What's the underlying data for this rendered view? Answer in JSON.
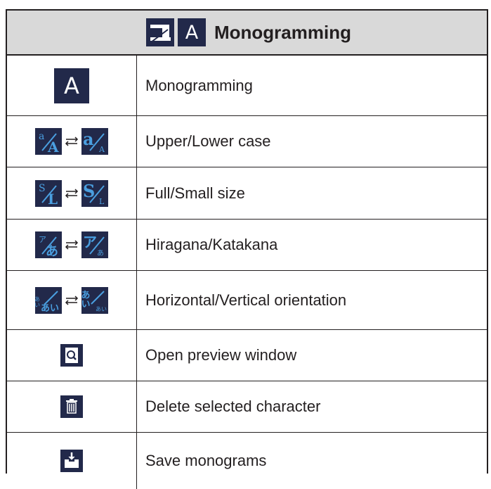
{
  "header": {
    "title": "Monogramming",
    "a_icon": "A",
    "machine_icon": "sewing-machine-icon"
  },
  "rows": [
    {
      "label": "Monogramming",
      "icon": "monogram-a-icon",
      "glyph": "A"
    },
    {
      "label": "Upper/Lower case",
      "icon_left": "case-lower-icon",
      "icon_right": "case-upper-icon",
      "left_top": "a",
      "left_bottom": "A",
      "right_top": "a",
      "right_bottom": "A"
    },
    {
      "label": "Full/Small size",
      "icon_left": "size-small-icon",
      "icon_right": "size-full-icon",
      "left_top": "S",
      "left_bottom": "L",
      "right_top": "S",
      "right_bottom": "L"
    },
    {
      "label": "Hiragana/Katakana",
      "icon_left": "hiragana-icon",
      "icon_right": "katakana-icon",
      "left_top": "ア",
      "left_bottom": "あ",
      "right_top": "ア",
      "right_bottom": "あ"
    },
    {
      "label": "Horizontal/Vertical orientation",
      "icon_left": "horizontal-orientation-icon",
      "icon_right": "vertical-orientation-icon",
      "left_top": "あい",
      "left_bottom": "あい",
      "right_top": "あい",
      "right_bottom": "あい"
    },
    {
      "label": "Open preview window",
      "icon": "preview-magnifier-icon"
    },
    {
      "label": "Delete selected character",
      "icon": "trash-icon"
    },
    {
      "label": "Save monograms",
      "icon": "save-download-icon"
    }
  ],
  "colors": {
    "icon_bg": "#22294a",
    "icon_fg": "#4a9fe0",
    "header_bg": "#d9d9d9",
    "border": "#231f20"
  }
}
